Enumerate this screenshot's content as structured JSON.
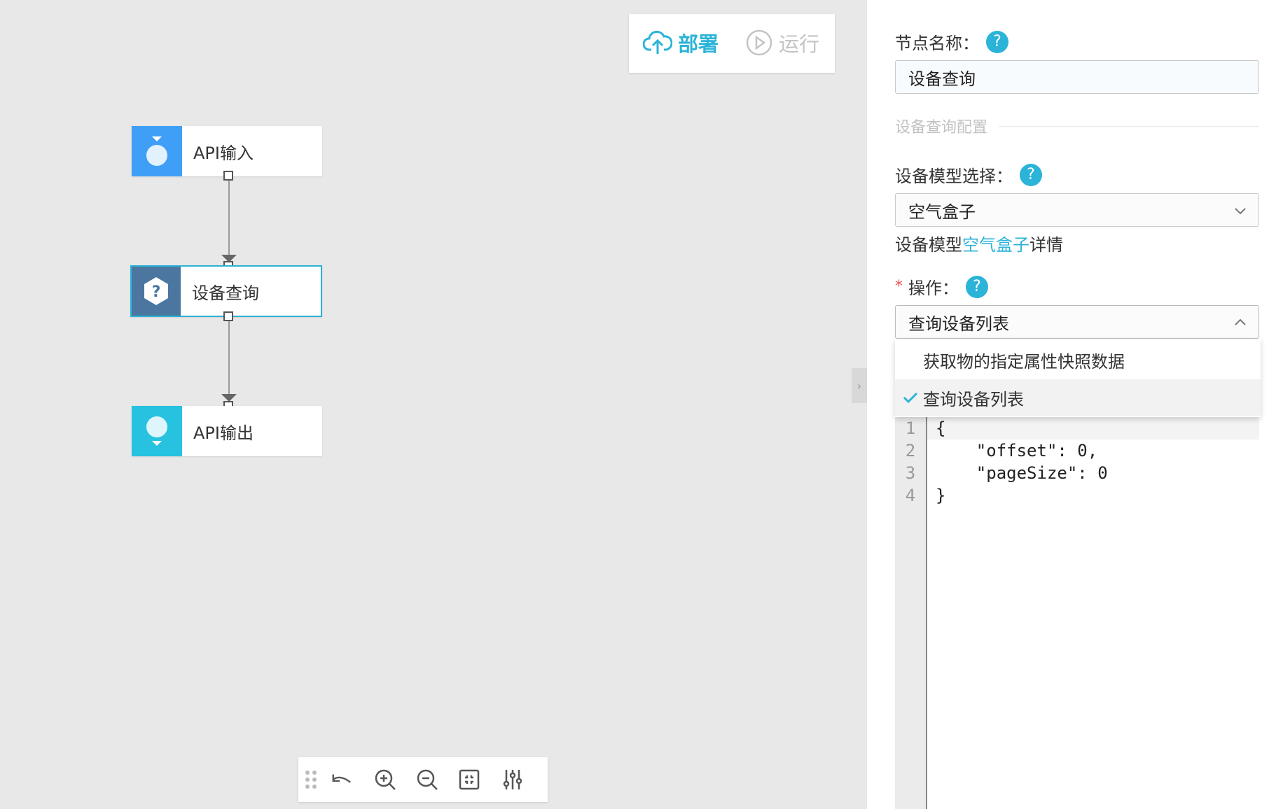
{
  "canvas": {
    "toolbar": {
      "deploy_label": "部署",
      "run_label": "运行"
    },
    "nodes": [
      {
        "label": "API输入",
        "icon": "api-input-icon",
        "color": "#3f9ff6"
      },
      {
        "label": "设备查询",
        "icon": "hexagon-question-icon",
        "color": "#4a76a0",
        "selected": true
      },
      {
        "label": "API输出",
        "icon": "api-output-icon",
        "color": "#27c2e0"
      }
    ],
    "bottom_toolbar": [
      "drag-handle-icon",
      "undo-icon",
      "zoom-in-icon",
      "zoom-out-icon",
      "fit-view-icon",
      "settings-sliders-icon"
    ]
  },
  "panel": {
    "node_name_label": "节点名称：",
    "node_name_value": "设备查询",
    "section_title": "设备查询配置",
    "model_label": "设备模型选择：",
    "model_value": "空气盒子",
    "model_detail_prefix": "设备模型",
    "model_detail_link": "空气盒子",
    "model_detail_suffix": "详情",
    "op_required": "*",
    "op_label": "操作：",
    "op_value": "查询设备列表",
    "op_options": [
      "获取物的指定属性快照数据",
      "查询设备列表"
    ],
    "help_glyph": "?",
    "code_lines": [
      "{",
      "    \"offset\": 0,",
      "    \"pageSize\": 0",
      "}"
    ],
    "line_numbers": [
      "1",
      "2",
      "3",
      "4"
    ]
  },
  "colors": {
    "accent": "#2bb3d8",
    "required": "#e55555"
  }
}
